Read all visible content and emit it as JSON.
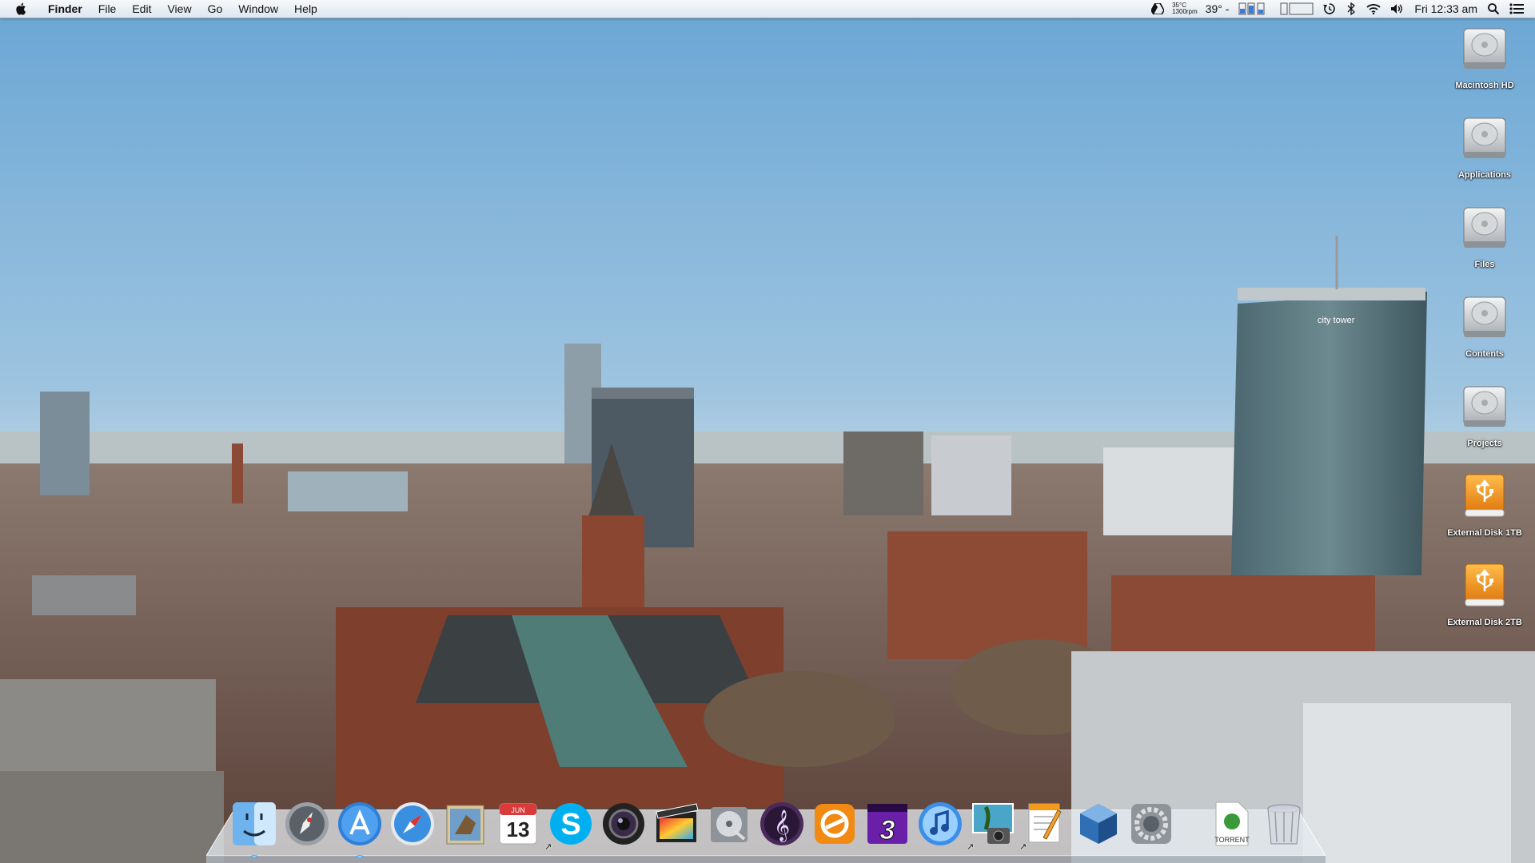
{
  "menubar": {
    "app_name": "Finder",
    "menus": [
      "File",
      "Edit",
      "View",
      "Go",
      "Window",
      "Help"
    ],
    "status": {
      "cpu_temp": "35°C",
      "fan_speed": "1300rpm",
      "weather": "39°",
      "weather_extra": "-",
      "clock": "Fri 12:33 am"
    }
  },
  "desktop_icons": [
    {
      "label": "Macintosh HD",
      "kind": "hard-drive"
    },
    {
      "label": "Applications",
      "kind": "hard-drive"
    },
    {
      "label": "Files",
      "kind": "hard-drive"
    },
    {
      "label": "Contents",
      "kind": "hard-drive"
    },
    {
      "label": "Projects",
      "kind": "hard-drive"
    },
    {
      "label": "External Disk 1TB",
      "kind": "usb-drive"
    },
    {
      "label": "External Disk 2TB",
      "kind": "usb-drive"
    }
  ],
  "wallpaper": {
    "sign_text": "city tower"
  },
  "dock": {
    "calendar_month": "JUN",
    "calendar_day": "13",
    "torrent_label": "TORRENT",
    "items": [
      "finder-icon",
      "launchpad-icon",
      "app-store-icon",
      "safari-icon",
      "mail-icon",
      "calendar-icon",
      "skype-icon",
      "photo-booth-icon",
      "final-cut-icon",
      "disk-utility-icon",
      "logic-icon",
      "amplitube-icon",
      "amplitube3-icon",
      "itunes-icon",
      "iphoto-icon",
      "pages-icon",
      "virtualbox-icon",
      "system-preferences-icon",
      "torrent-file-icon",
      "trash-icon"
    ]
  },
  "colors": {
    "sky_top": "#6fa9d6",
    "sky_bottom": "#c9dde8",
    "menubar": "#eef2f6",
    "usb_orange": "#f29a1c"
  }
}
